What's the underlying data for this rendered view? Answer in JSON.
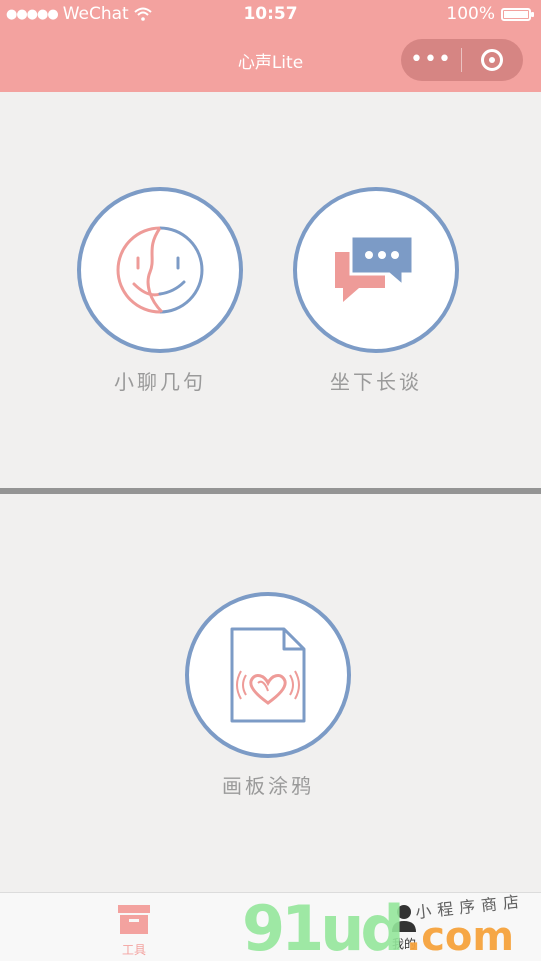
{
  "status_bar": {
    "signal_dots": "●●●●●",
    "carrier": "WeChat",
    "time": "10:57",
    "battery": "100%",
    "battery_level": 1.0
  },
  "nav": {
    "title": "心声Lite",
    "more_glyph": "•••"
  },
  "features": [
    {
      "label": "小聊几句",
      "icon": "face-icon"
    },
    {
      "label": "坐下长谈",
      "icon": "chat-bubbles-icon"
    },
    {
      "label": "画板涂鸦",
      "icon": "doodle-file-icon"
    }
  ],
  "tabbar": {
    "tabs": [
      {
        "label": "工具",
        "icon": "toolbox-icon",
        "active": true
      },
      {
        "label": "我的",
        "icon": "person-icon",
        "active": false
      }
    ]
  },
  "watermark": {
    "brand": "91ud",
    "domain": ".com",
    "tagline": "小程序商店"
  },
  "colors": {
    "accent": "#f3a29f",
    "icon_blue": "#7c9bc6",
    "icon_pink": "#ee9b98",
    "label_gray": "#9a9a9a"
  }
}
